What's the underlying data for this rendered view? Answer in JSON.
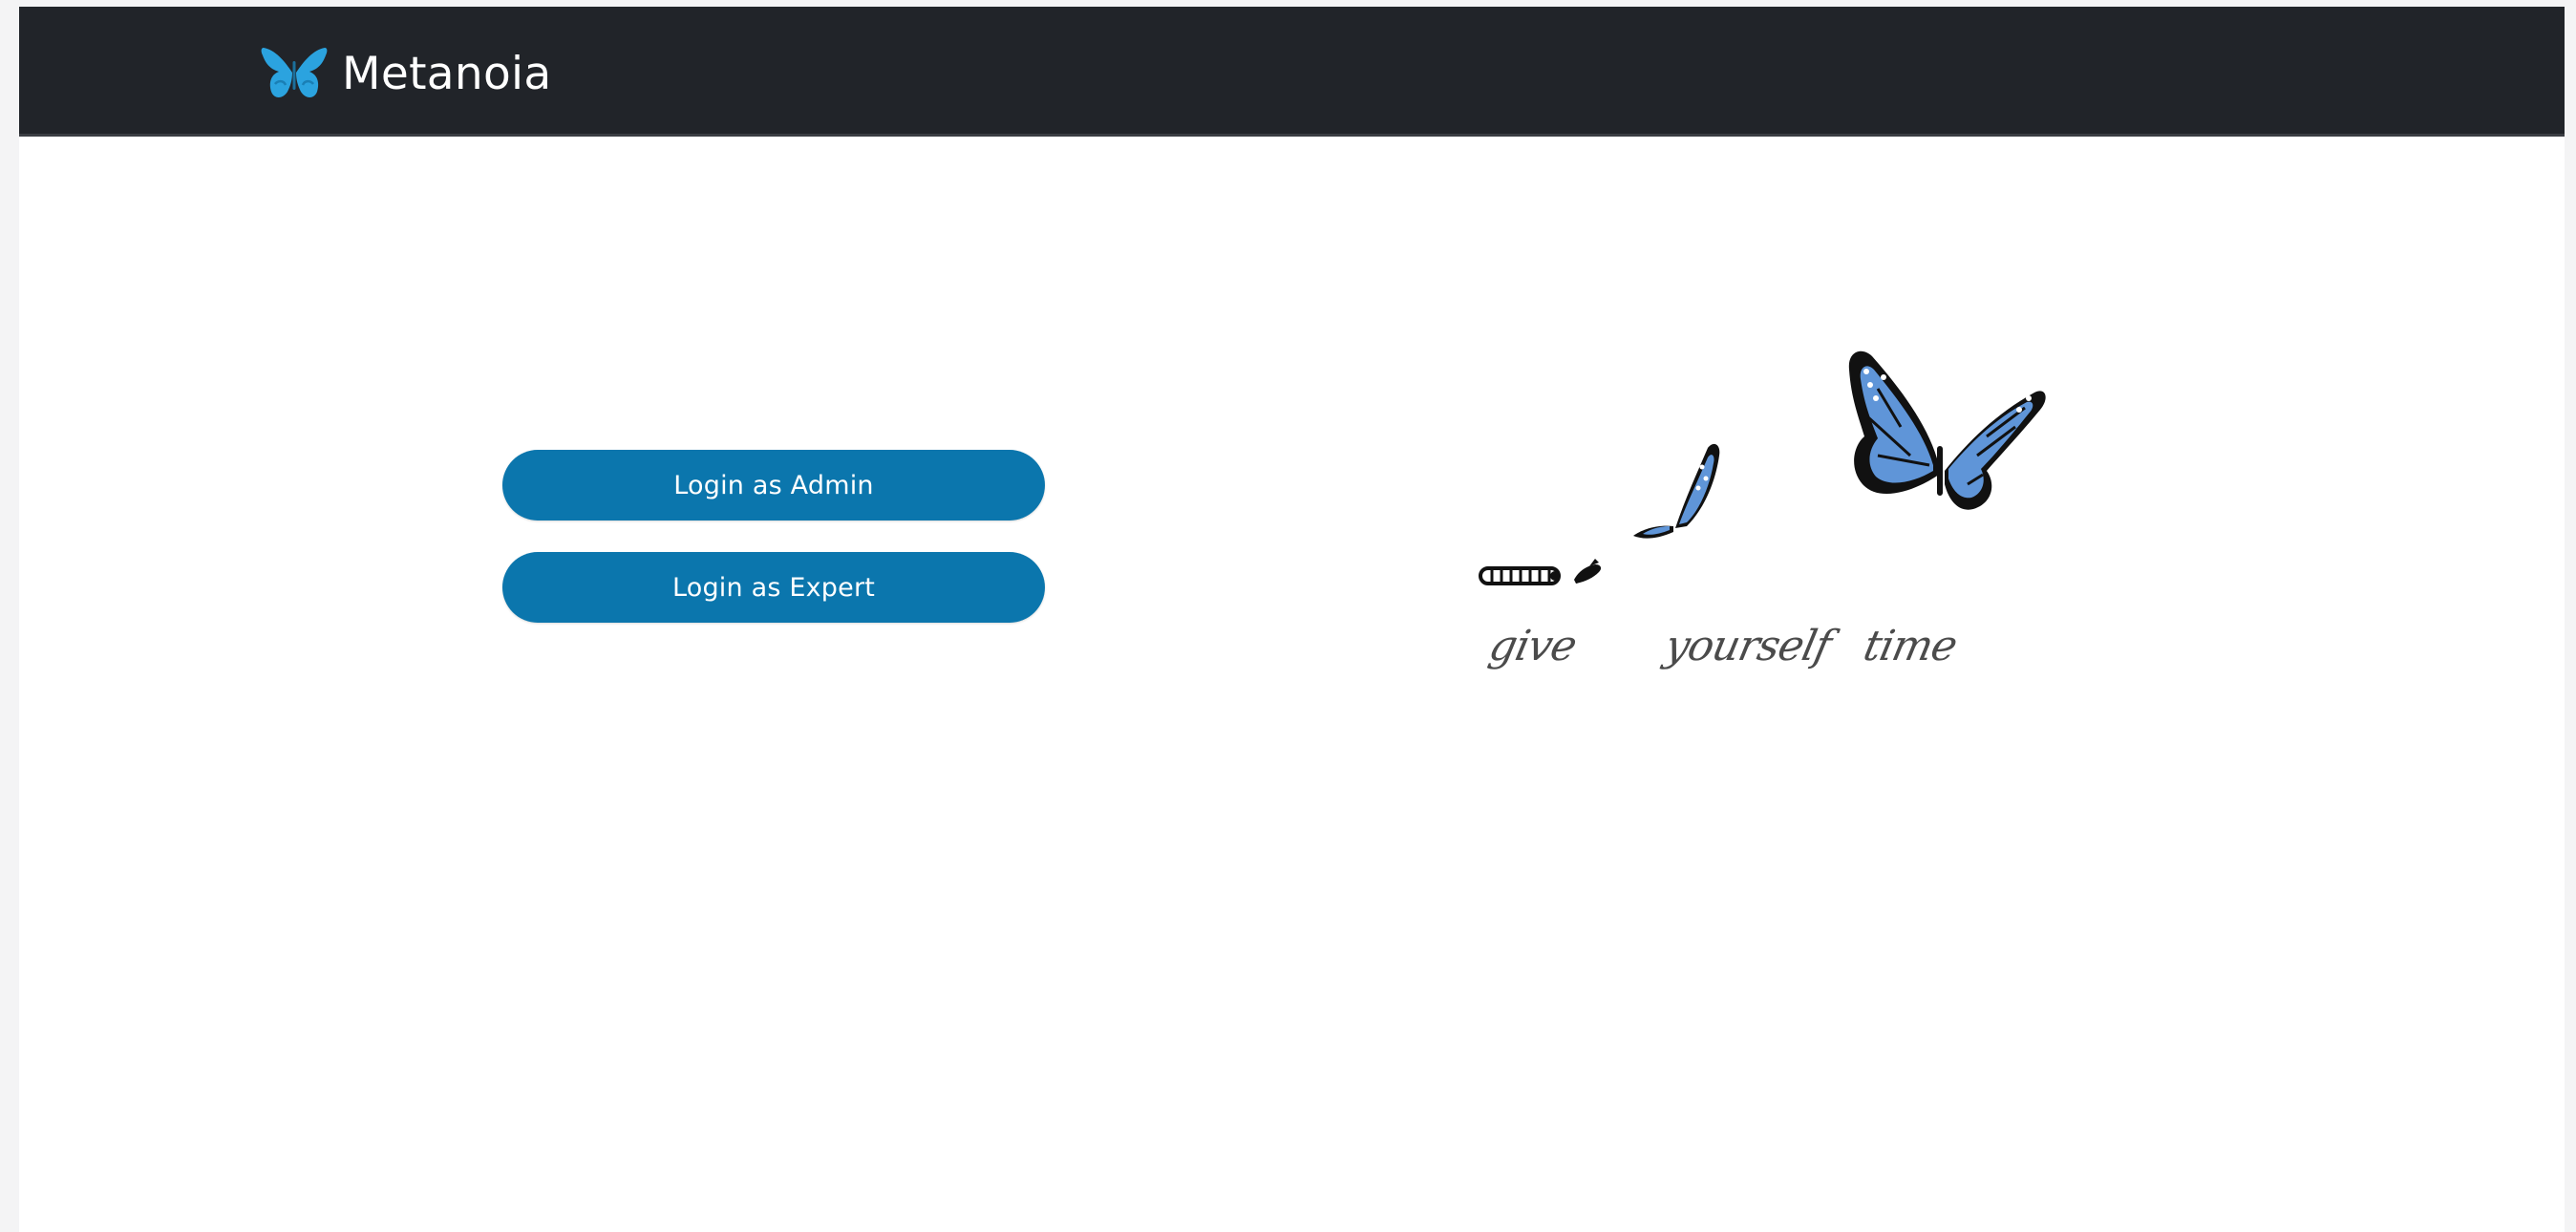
{
  "app": {
    "brand_name": "Metanoia",
    "brand_icon": "butterfly-icon",
    "accent_color": "#0b76ad",
    "navbar_color": "#212429"
  },
  "actions": {
    "login_admin_label": "Login as Admin",
    "login_expert_label": "Login as Expert"
  },
  "hero": {
    "caption_words": [
      "give",
      "yourself",
      "time"
    ]
  }
}
